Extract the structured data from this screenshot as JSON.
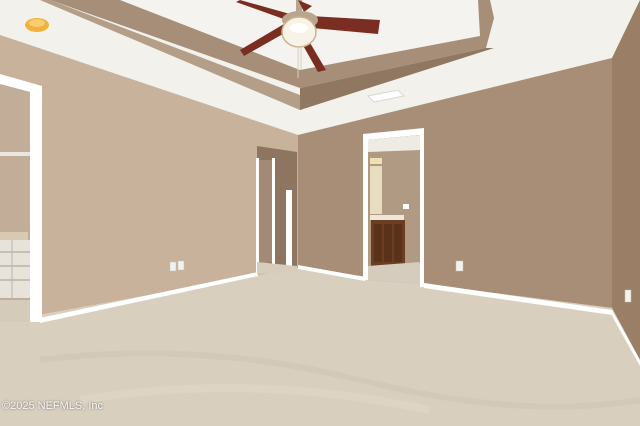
{
  "watermark": {
    "text": "©2025 NEFMLS, Inc"
  },
  "colors": {
    "ceiling": "#f2f1ec",
    "ceiling_tray_band": "#9c8670",
    "wall_left": "#c9b29c",
    "wall_back": "#a98f78",
    "wall_right": "#9a7e66",
    "carpet": "#d9cfbe",
    "trim": "#ffffff",
    "cabinet": "#6b3e22",
    "fan_blade": "#7a2e22"
  },
  "icons": [
    "ceiling-fan-icon",
    "light-fixture-icon",
    "outlet-icon"
  ]
}
